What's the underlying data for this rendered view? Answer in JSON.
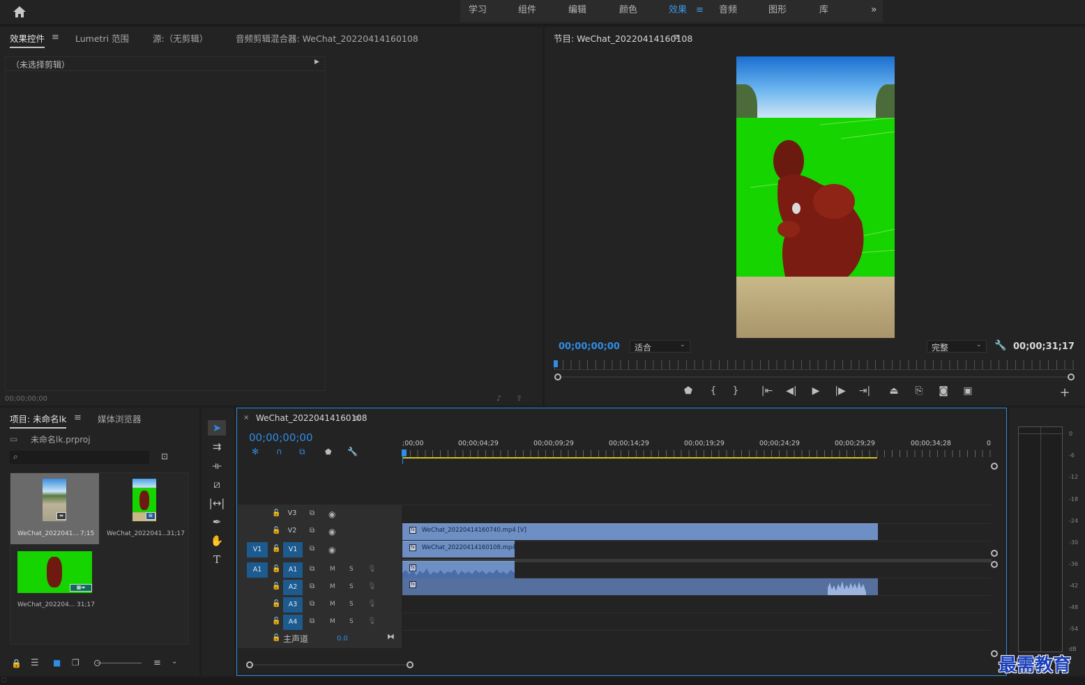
{
  "workspace_bar": {
    "tabs": [
      "学习",
      "组件",
      "编辑",
      "颜色",
      "效果",
      "音频",
      "图形",
      "库"
    ],
    "active_tab": "效果",
    "menu_icon": "hamburger-icon",
    "overflow_icon": "double-chevron-right-icon"
  },
  "effects_panel": {
    "tabs": [
      "效果控件",
      "Lumetri 范围",
      "源:（无剪辑）",
      "音频剪辑混合器: WeChat_20220414160108"
    ],
    "active_tab": "效果控件",
    "clip_header": "（未选择剪辑）",
    "timecode": "00;00;00;00"
  },
  "program_monitor": {
    "title": "节目: WeChat_20220414160108",
    "timecode": "00;00;00;00",
    "fit_label": "适合",
    "quality_label": "完整",
    "duration": "00;00;31;17"
  },
  "project_panel": {
    "tabs": [
      "项目: 未命名lk",
      "媒体浏览器"
    ],
    "active_tab": "项目: 未命名lk",
    "project_file": "未命名lk.prproj",
    "search_placeholder": "",
    "items": [
      {
        "name": "WeChat_2022041...",
        "duration": "7;15"
      },
      {
        "name": "WeChat_2022041...",
        "duration": "31;17"
      },
      {
        "name": "WeChat_202204...",
        "duration": "31;17"
      }
    ]
  },
  "timeline": {
    "sequence_name": "WeChat_20220414160108",
    "timecode": "00;00;00;00",
    "ruler_labels": [
      ";00;00",
      "00;00;04;29",
      "00;00;09;29",
      "00;00;14;29",
      "00;00;19;29",
      "00;00;24;29",
      "00;00;29;29",
      "00;00;34;28",
      "0"
    ],
    "video_tracks": [
      "V3",
      "V2",
      "V1"
    ],
    "audio_tracks": [
      "A1",
      "A2",
      "A3",
      "A4"
    ],
    "source_patch_video": "V1",
    "source_patch_audio": "A1",
    "mute_label": "M",
    "solo_label": "S",
    "master_label": "主声道",
    "master_value": "0.0",
    "clips": {
      "v2": "WeChat_20220414160740.mp4 [V]",
      "v1": "WeChat_20220414160108.mp4"
    }
  },
  "audio_meter": {
    "scale": [
      "0",
      "-6",
      "-12",
      "-18",
      "-24",
      "-30",
      "-36",
      "-42",
      "-48",
      "-54",
      "dB"
    ]
  },
  "watermark": "最需教育",
  "colors": {
    "accent": "#2f8de4",
    "panel_bg": "#232323",
    "green_screen": "#16d400",
    "clip_video": "#6d8fc4"
  }
}
